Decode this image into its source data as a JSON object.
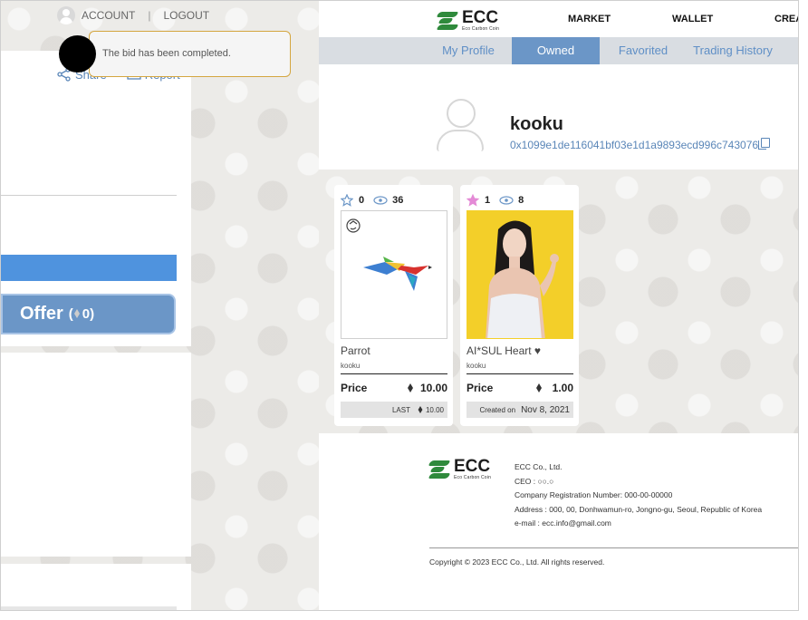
{
  "left_panel": {
    "account_label": "ACCOUNT",
    "separator": "|",
    "logout_label": "LOGOUT",
    "share_label": "Share",
    "report_label": "Report",
    "offer_label": "Offer",
    "offer_count": "0"
  },
  "toast": {
    "message": "The bid has been completed."
  },
  "nav": {
    "logo_text": "ECC",
    "logo_subtext": "Eco Carbon Coin",
    "links": [
      "MARKET",
      "WALLET",
      "CREATE"
    ]
  },
  "tabs": [
    {
      "label": "My Profile",
      "active": false
    },
    {
      "label": "Owned",
      "active": true
    },
    {
      "label": "Favorited",
      "active": false
    },
    {
      "label": "Trading History",
      "active": false
    }
  ],
  "profile": {
    "username": "kooku",
    "address": "0x1099e1de116041bf03e1d1a9893ecd996c743076"
  },
  "nfts": [
    {
      "favorites": "0",
      "views": "36",
      "name": "Parrot",
      "owner": "kooku",
      "price_label": "Price",
      "price": "10.00",
      "footer_label": "LAST",
      "footer_value": "10.00",
      "star_color": "#6b96c7",
      "starred": false
    },
    {
      "favorites": "1",
      "views": "8",
      "name": "AI*SUL Heart ♥",
      "owner": "kooku",
      "price_label": "Price",
      "price": "1.00",
      "footer_label": "Created on",
      "footer_value": "Nov 8, 2021",
      "star_color": "#e48ad6",
      "starred": true
    }
  ],
  "footer": {
    "logo_text": "ECC",
    "logo_subtext": "Eco Carbon Coin",
    "company": "ECC Co., Ltd.",
    "ceo": "CEO : ○○.○",
    "registration": "Company Registration Number: 000-00-00000",
    "address": "Address : 000, 00, Donhwamun-ro, Jongno-gu, Seoul, Republic of Korea",
    "email": "e-mail : ecc.info@gmail.com",
    "copyright": "Copyright © 2023 ECC Co., Ltd. All rights reserved."
  },
  "colors": {
    "accent": "#6b96c7",
    "brand_green": "#2f8a3c",
    "link": "#5a86b8",
    "toast_border": "#d4a640"
  }
}
